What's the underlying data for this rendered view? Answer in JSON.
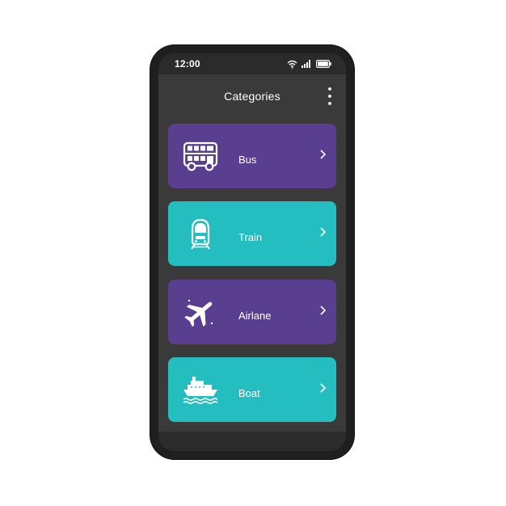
{
  "status_bar": {
    "time": "12:00",
    "icons": [
      "wifi-icon",
      "signal-icon",
      "battery-icon"
    ]
  },
  "header": {
    "title": "Categories",
    "menu_icon": "more-vertical-icon"
  },
  "colors": {
    "purple": "#5A3E8F",
    "teal": "#25BEC0",
    "screen_bg": "#3A3A3A",
    "bar_bg": "#2B2B2B",
    "phone_frame": "#1F1F1F",
    "text": "#FFFFFF"
  },
  "categories": [
    {
      "label": "Bus",
      "icon": "bus-icon",
      "color": "#5A3E8F"
    },
    {
      "label": "Train",
      "icon": "train-icon",
      "color": "#25BEC0"
    },
    {
      "label": "Airlane",
      "icon": "airplane-icon",
      "color": "#5A3E8F"
    },
    {
      "label": "Boat",
      "icon": "boat-icon",
      "color": "#25BEC0"
    }
  ]
}
